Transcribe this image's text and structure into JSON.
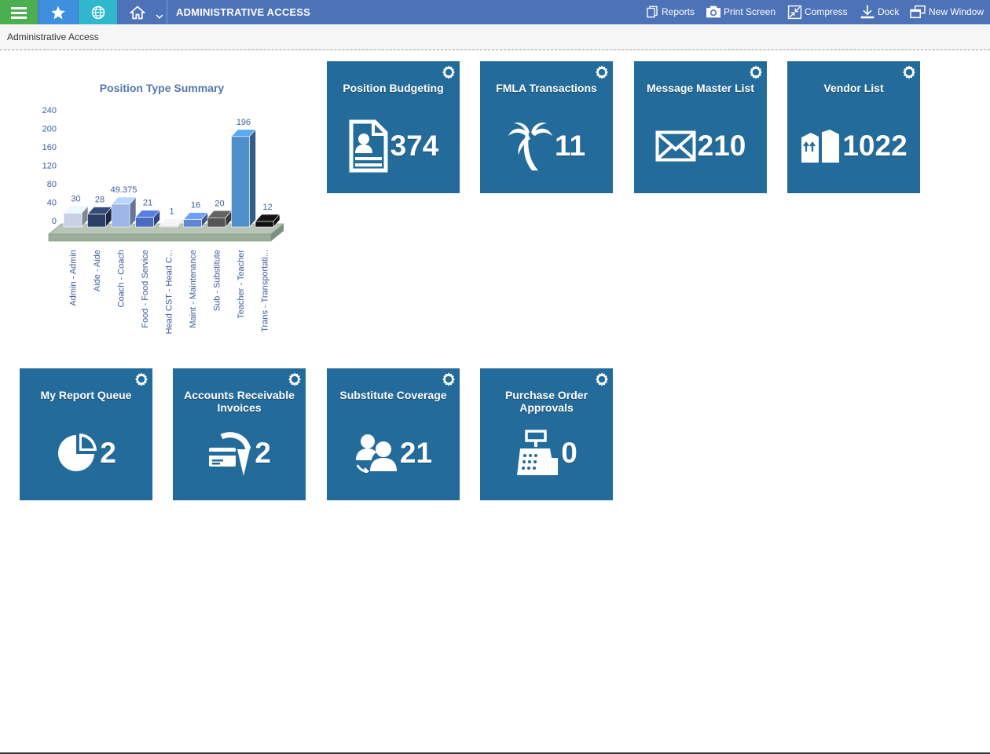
{
  "topbar": {
    "title": "ADMINISTRATIVE ACCESS",
    "actions": [
      {
        "label": "Reports",
        "icon": "reports-icon"
      },
      {
        "label": "Print Screen",
        "icon": "camera-icon"
      },
      {
        "label": "Compress",
        "icon": "compress-icon"
      },
      {
        "label": "Dock",
        "icon": "dock-icon"
      },
      {
        "label": "New Window",
        "icon": "new-window-icon"
      }
    ],
    "colors": {
      "bar": "#4d72b8",
      "menu": "#4caf4f",
      "favorites": "#3e8fe0",
      "globe": "#2fb7cc"
    }
  },
  "breadcrumb": "Administrative Access",
  "chart_data": {
    "type": "bar",
    "title": "Position Type Summary",
    "categories": [
      "Admin - Admin",
      "Aide - Aide",
      "Coach - Coach",
      "Food - Food Service",
      "Head CST - Head C...",
      "Maint - Maintenance",
      "Sub - Substitute",
      "Teacher - Teacher",
      "Trans - Transportati..."
    ],
    "values": [
      30,
      28,
      49.375,
      21,
      1,
      16,
      20,
      196,
      12
    ],
    "value_labels": [
      "30",
      "28",
      "49.375",
      "21",
      "1",
      "16",
      "20",
      "196",
      "12"
    ],
    "yticks": [
      "0",
      "40",
      "80",
      "120",
      "160",
      "200",
      "240"
    ],
    "ylim": [
      0,
      240
    ],
    "style": "3d",
    "colors": [
      "#c7d2e6",
      "#2c3f66",
      "#9cb6e6",
      "#4a6bbf",
      "#d0d0d0",
      "#5f86d6",
      "#555555",
      "#4f8fcb",
      "#111111"
    ]
  },
  "tiles": [
    {
      "title": "Position Budgeting",
      "count": "374",
      "icon": "profile-document-icon"
    },
    {
      "title": "FMLA Transactions",
      "count": "11",
      "icon": "palm-tree-icon"
    },
    {
      "title": "Message Master List",
      "count": "210",
      "icon": "envelope-icon"
    },
    {
      "title": "Vendor List",
      "count": "1022",
      "icon": "boxes-icon"
    },
    {
      "title": "My Report Queue",
      "count": "2",
      "icon": "pie-chart-icon"
    },
    {
      "title": "Accounts Receivable Invoices",
      "count": "2",
      "icon": "card-invoice-icon"
    },
    {
      "title": "Substitute Coverage",
      "count": "21",
      "icon": "user-swap-icon"
    },
    {
      "title": "Purchase Order Approvals",
      "count": "0",
      "icon": "cash-register-icon"
    }
  ],
  "tile_color": "#236b9b"
}
